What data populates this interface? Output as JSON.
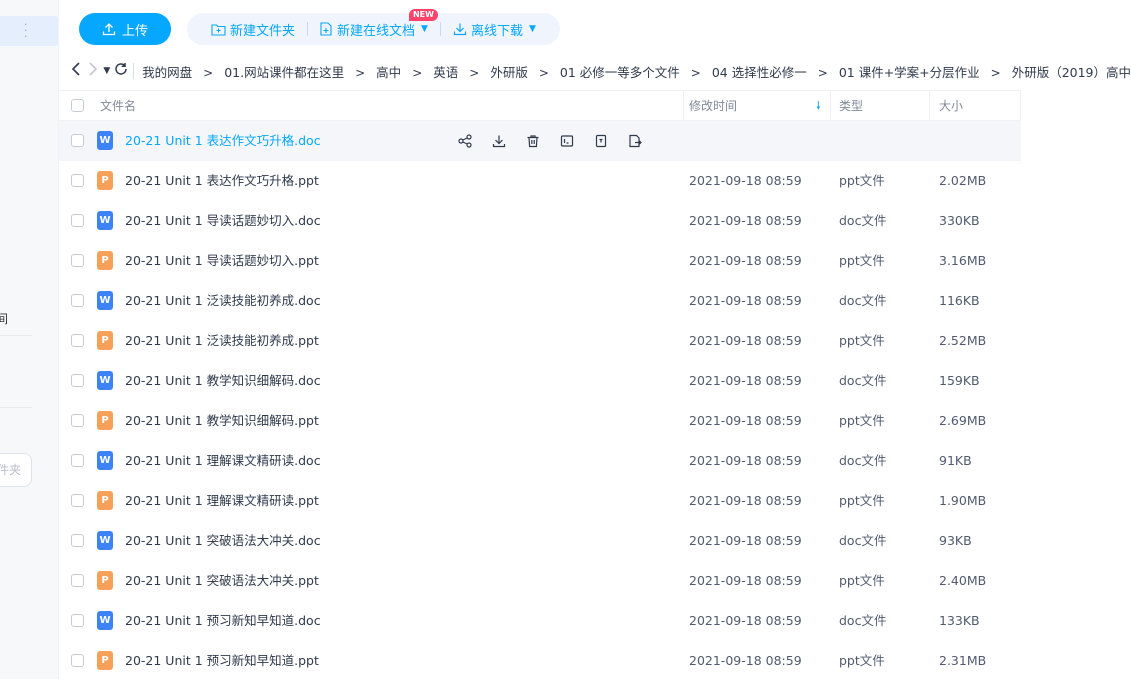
{
  "toolbar": {
    "upload_label": "上传",
    "new_folder_label": "新建文件夹",
    "new_online_doc_label": "新建在线文档",
    "new_badge": "NEW",
    "offline_download_label": "离线下载"
  },
  "sidebar": {
    "fragment_text": "间",
    "folder_button_fragment": "件夹"
  },
  "breadcrumb": [
    "我的网盘",
    "01.网站课件都在这里",
    "高中",
    "英语",
    "外研版",
    "01 必修一等多个文件",
    "04 选择性必修一",
    "01  课件+学案+分层作业",
    "外研版（2019）高中"
  ],
  "table": {
    "headers": {
      "name": "文件名",
      "modified": "修改时间",
      "type": "类型",
      "size": "大小"
    },
    "rows": [
      {
        "name": "20-21 Unit 1 表达作文巧升格.doc",
        "date": "",
        "type": "",
        "size": "",
        "kind": "doc"
      },
      {
        "name": "20-21 Unit 1 表达作文巧升格.ppt",
        "date": "2021-09-18 08:59",
        "type": "ppt文件",
        "size": "2.02MB",
        "kind": "ppt"
      },
      {
        "name": "20-21 Unit 1 导读话题妙切入.doc",
        "date": "2021-09-18 08:59",
        "type": "doc文件",
        "size": "330KB",
        "kind": "doc"
      },
      {
        "name": "20-21 Unit 1 导读话题妙切入.ppt",
        "date": "2021-09-18 08:59",
        "type": "ppt文件",
        "size": "3.16MB",
        "kind": "ppt"
      },
      {
        "name": "20-21 Unit 1 泛读技能初养成.doc",
        "date": "2021-09-18 08:59",
        "type": "doc文件",
        "size": "116KB",
        "kind": "doc"
      },
      {
        "name": "20-21 Unit 1 泛读技能初养成.ppt",
        "date": "2021-09-18 08:59",
        "type": "ppt文件",
        "size": "2.52MB",
        "kind": "ppt"
      },
      {
        "name": "20-21 Unit 1 教学知识细解码.doc",
        "date": "2021-09-18 08:59",
        "type": "doc文件",
        "size": "159KB",
        "kind": "doc"
      },
      {
        "name": "20-21 Unit 1 教学知识细解码.ppt",
        "date": "2021-09-18 08:59",
        "type": "ppt文件",
        "size": "2.69MB",
        "kind": "ppt"
      },
      {
        "name": "20-21 Unit 1 理解课文精研读.doc",
        "date": "2021-09-18 08:59",
        "type": "doc文件",
        "size": "91KB",
        "kind": "doc"
      },
      {
        "name": "20-21 Unit 1 理解课文精研读.ppt",
        "date": "2021-09-18 08:59",
        "type": "ppt文件",
        "size": "1.90MB",
        "kind": "ppt"
      },
      {
        "name": "20-21 Unit 1 突破语法大冲关.doc",
        "date": "2021-09-18 08:59",
        "type": "doc文件",
        "size": "93KB",
        "kind": "doc"
      },
      {
        "name": "20-21 Unit 1 突破语法大冲关.ppt",
        "date": "2021-09-18 08:59",
        "type": "ppt文件",
        "size": "2.40MB",
        "kind": "ppt"
      },
      {
        "name": "20-21 Unit 1 预习新知早知道.doc",
        "date": "2021-09-18 08:59",
        "type": "doc文件",
        "size": "133KB",
        "kind": "doc"
      },
      {
        "name": "20-21 Unit 1 预习新知早知道.ppt",
        "date": "2021-09-18 08:59",
        "type": "ppt文件",
        "size": "2.31MB",
        "kind": "ppt"
      }
    ]
  },
  "icons": {
    "doc_glyph": "W",
    "ppt_glyph": "P",
    "row_actions": [
      "share-icon",
      "download-icon",
      "delete-icon",
      "rename-icon",
      "copy-icon",
      "move-icon"
    ]
  },
  "colors": {
    "accent": "#06a7ff",
    "doc_icon": "#3e83f5",
    "ppt_icon": "#f6a05a",
    "new_badge": "#ff436a"
  }
}
